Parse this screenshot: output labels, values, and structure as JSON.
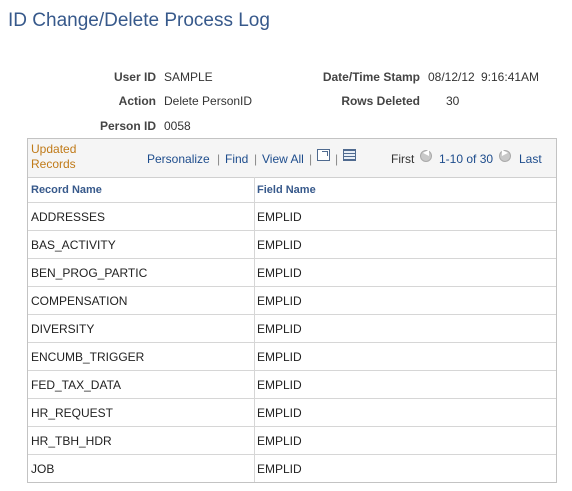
{
  "page": {
    "title": "ID Change/Delete Process Log"
  },
  "info": {
    "user_id_label": "User ID",
    "user_id": "SAMPLE",
    "action_label": "Action",
    "action": "Delete PersonID",
    "person_id_label": "Person ID",
    "person_id": "0058",
    "date_label": "Date/Time Stamp",
    "date_value": "08/12/12",
    "time_value": "9:16:41AM",
    "rows_deleted_label": "Rows Deleted",
    "rows_deleted": "30"
  },
  "grid": {
    "title": "Updated Records",
    "personalize": "Personalize",
    "find": "Find",
    "view_all": "View All",
    "first": "First",
    "range": "1-10 of 30",
    "last": "Last",
    "columns": [
      "Record Name",
      "Field Name"
    ],
    "rows": [
      [
        "ADDRESSES",
        "EMPLID"
      ],
      [
        "BAS_ACTIVITY",
        "EMPLID"
      ],
      [
        "BEN_PROG_PARTIC",
        "EMPLID"
      ],
      [
        "COMPENSATION",
        "EMPLID"
      ],
      [
        "DIVERSITY",
        "EMPLID"
      ],
      [
        "ENCUMB_TRIGGER",
        "EMPLID"
      ],
      [
        "FED_TAX_DATA",
        "EMPLID"
      ],
      [
        "HR_REQUEST",
        "EMPLID"
      ],
      [
        "HR_TBH_HDR",
        "EMPLID"
      ],
      [
        "JOB",
        "EMPLID"
      ]
    ]
  }
}
